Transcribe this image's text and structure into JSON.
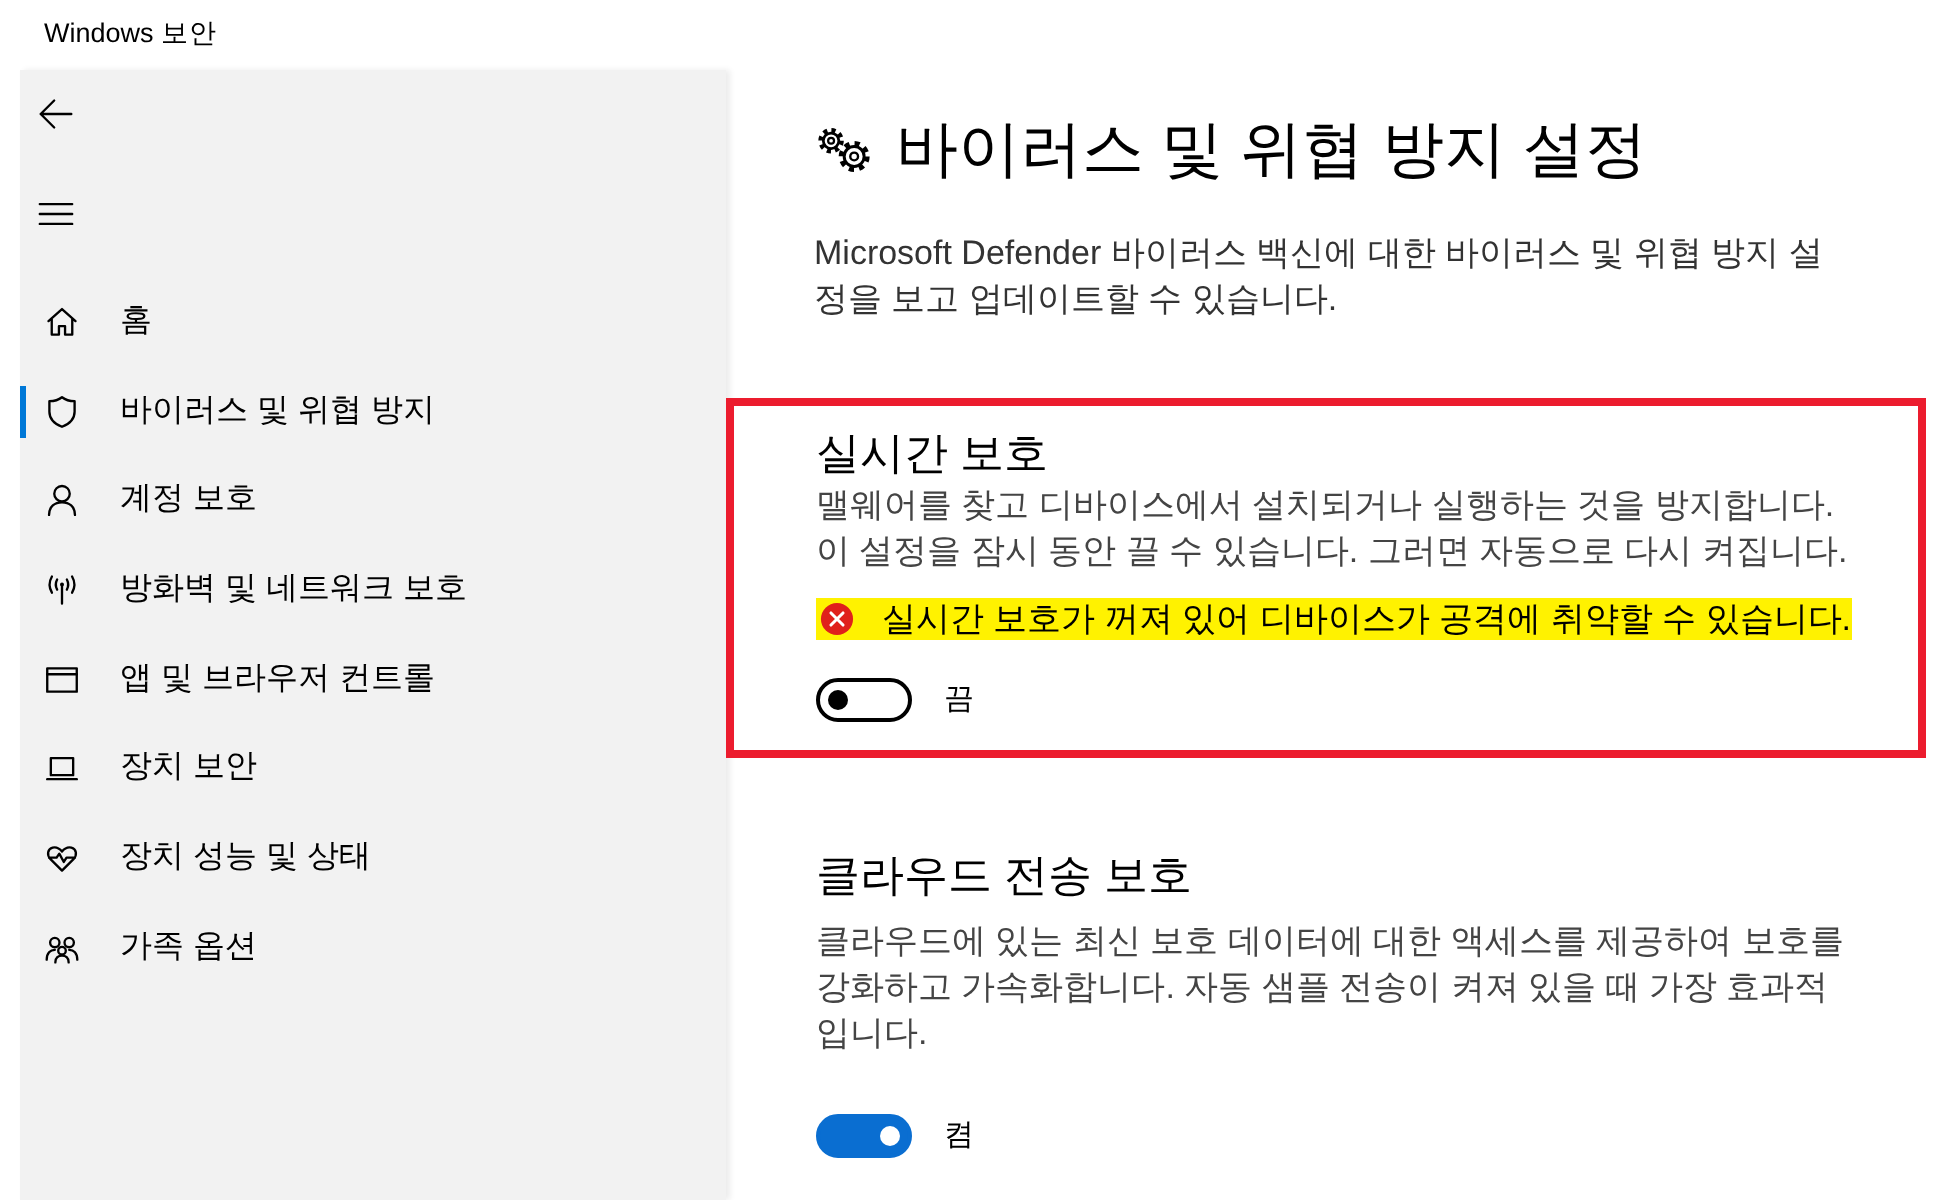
{
  "window": {
    "title": "Windows 보안"
  },
  "sidebar": {
    "items": [
      {
        "label": "홈",
        "selected": false
      },
      {
        "label": "바이러스 및 위협 방지",
        "selected": true
      },
      {
        "label": "계정 보호",
        "selected": false
      },
      {
        "label": "방화벽 및 네트워크 보호",
        "selected": false
      },
      {
        "label": "앱 및 브라우저 컨트롤",
        "selected": false
      },
      {
        "label": "장치 보안",
        "selected": false
      },
      {
        "label": "장치 성능 및 상태",
        "selected": false
      },
      {
        "label": "가족 옵션",
        "selected": false
      }
    ]
  },
  "page": {
    "title": "바이러스 및 위협 방지 설정",
    "description": "Microsoft Defender 바이러스 백신에 대한 바이러스 및 위협 방지 설정을 보고 업데이트할 수 있습니다."
  },
  "sections": [
    {
      "title": "실시간 보호",
      "description": "맬웨어를 찾고 디바이스에서 설치되거나 실행하는 것을 방지합니다. 이 설정을 잠시 동안 끌 수 있습니다. 그러면 자동으로 다시 켜집니다.",
      "highlighted": true,
      "warning": {
        "text": "실시간 보호가 꺼져 있어 디바이스가 공격에 취약할 수 있습니다.",
        "highlighted": true
      },
      "toggle": {
        "on": false,
        "label": "끔"
      }
    },
    {
      "title": "클라우드 전송 보호",
      "description": "클라우드에 있는 최신 보호 데이터에 대한 액세스를 제공하여 보호를 강화하고 가속화합니다. 자동 샘플 전송이 켜져 있을 때 가장 효과적입니다.",
      "highlighted": false,
      "toggle": {
        "on": true,
        "label": "켬"
      }
    }
  ]
}
